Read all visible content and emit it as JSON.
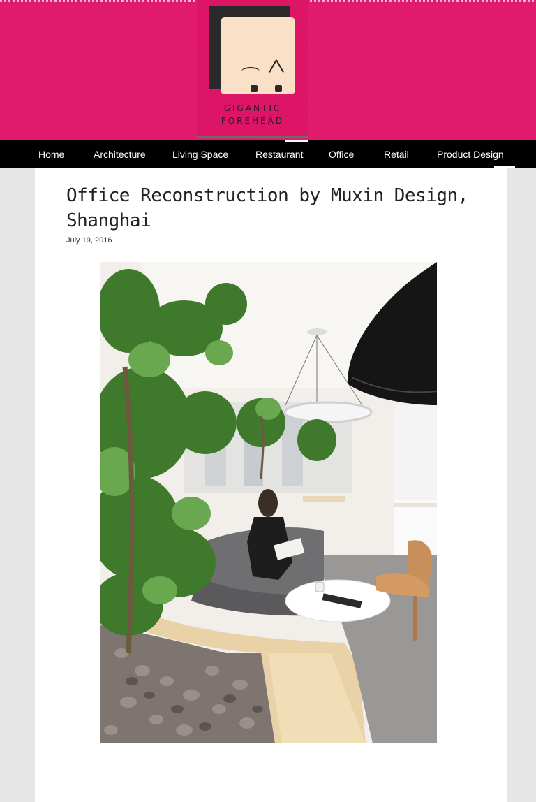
{
  "site": {
    "logo_line1": "GIGANTIC",
    "logo_line2": "FOREHEAD",
    "brand_color": "#e0196a"
  },
  "nav": {
    "items": [
      {
        "label": "Home"
      },
      {
        "label": "Architecture"
      },
      {
        "label": "Living Space"
      },
      {
        "label": "Restaurant"
      },
      {
        "label": "Office"
      },
      {
        "label": "Retail"
      },
      {
        "label": "Product Design"
      }
    ]
  },
  "post": {
    "title": "Office Reconstruction by Muxin Design, Shanghai",
    "date": "July 19, 2016"
  },
  "icons": {
    "logo": "gigantic-forehead-face-icon"
  }
}
